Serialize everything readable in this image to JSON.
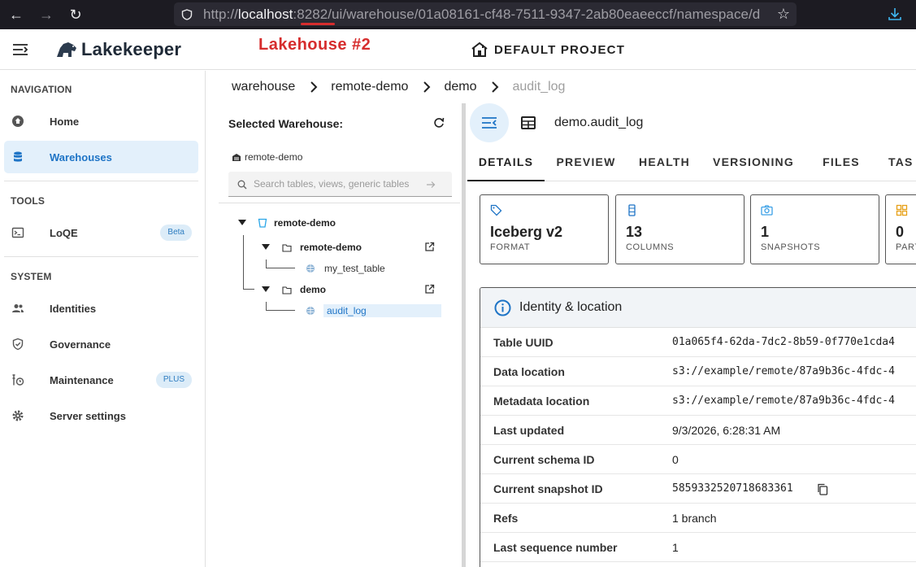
{
  "browser": {
    "url_prefix": "http://",
    "url_host": "localhost",
    "url_rest": ":8282/ui/warehouse/01a08161-cf48-7511-9347-2ab80eaeeccf/namespace/d"
  },
  "header": {
    "logo_text": "Lakekeeper",
    "annotation": "Lakehouse  #2",
    "project": "DEFAULT PROJECT"
  },
  "sidebar": {
    "navigation_title": "NAVIGATION",
    "tools_title": "TOOLS",
    "system_title": "SYSTEM",
    "items": [
      {
        "label": "Home"
      },
      {
        "label": "Warehouses"
      },
      {
        "label": "LoQE",
        "badge": "Beta"
      },
      {
        "label": "Identities"
      },
      {
        "label": "Governance"
      },
      {
        "label": "Maintenance",
        "badge": "PLUS"
      },
      {
        "label": "Server settings"
      }
    ]
  },
  "breadcrumb": [
    "warehouse",
    "remote-demo",
    "demo",
    "audit_log"
  ],
  "tree": {
    "selected_title": "Selected Warehouse:",
    "warehouse": "remote-demo",
    "search_placeholder": "Search tables, views, generic tables",
    "root": "remote-demo",
    "namespaces": [
      {
        "name": "remote-demo",
        "children": [
          "my_test_table"
        ]
      },
      {
        "name": "demo",
        "children": [
          "audit_log"
        ]
      }
    ]
  },
  "detail": {
    "title": "demo.audit_log",
    "tabs": [
      "DETAILS",
      "PREVIEW",
      "HEALTH",
      "VERSIONING",
      "FILES",
      "TAS"
    ],
    "cards": [
      {
        "value": "Iceberg v2",
        "label": "FORMAT",
        "icon": "tag-icon"
      },
      {
        "value": "13",
        "label": "COLUMNS",
        "icon": "columns-icon"
      },
      {
        "value": "1",
        "label": "SNAPSHOTS",
        "icon": "camera-icon"
      },
      {
        "value": "0",
        "label": "PART",
        "icon": "grid-icon"
      }
    ],
    "info_title": "Identity & location",
    "rows": [
      {
        "key": "Table UUID",
        "value": "01a065f4-62da-7dc2-8b59-0f770e1cda4"
      },
      {
        "key": "Data location",
        "value": "s3://example/remote/87a9b36c-4fdc-4"
      },
      {
        "key": "Metadata location",
        "value": "s3://example/remote/87a9b36c-4fdc-4"
      },
      {
        "key": "Last updated",
        "value": "9/3/2026, 6:28:31 AM"
      },
      {
        "key": "Current schema ID",
        "value": "0"
      },
      {
        "key": "Current snapshot ID",
        "value": "5859332520718683361"
      },
      {
        "key": "Refs",
        "value": "1 branch"
      },
      {
        "key": "Last sequence number",
        "value": "1"
      }
    ]
  },
  "colors": {
    "accent": "#1e74c6",
    "annotation": "#d62d2d"
  }
}
